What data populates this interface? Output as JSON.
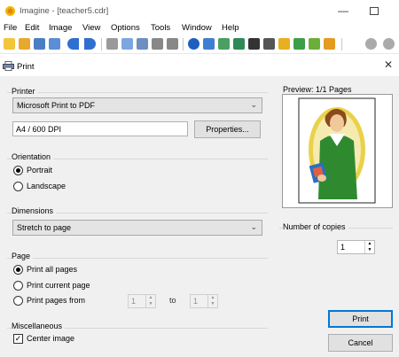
{
  "app": {
    "title": "Imagine - [teacher5.cdr]",
    "min_glyph": "—"
  },
  "menu": [
    "File",
    "Edit",
    "Image",
    "View",
    "Options",
    "Tools",
    "Window",
    "Help"
  ],
  "dialog": {
    "title": "Print",
    "close_glyph": "✕"
  },
  "printer": {
    "label": "Printer",
    "selected": "Microsoft Print to PDF",
    "info": "A4  /  600 DPI",
    "properties_label": "Properties..."
  },
  "orientation": {
    "label": "Orientation",
    "portrait": "Portrait",
    "landscape": "Landscape",
    "selected": "Portrait"
  },
  "dimensions": {
    "label": "Dimensions",
    "selected": "Stretch to page"
  },
  "page": {
    "label": "Page",
    "all": "Print all pages",
    "current": "Print current page",
    "range": "Print pages from",
    "from": "1",
    "to_label": "to",
    "to": "1",
    "selected": "all"
  },
  "misc": {
    "label": "Miscellaneous",
    "center_image": "Center image",
    "center_checked": true
  },
  "preview": {
    "label": "Preview: 1/1 Pages"
  },
  "copies": {
    "label": "Number of copies",
    "value": "1"
  },
  "actions": {
    "print": "Print",
    "cancel": "Cancel"
  },
  "colors": {
    "dialog_bg": "#f0f0f0",
    "default_button_border": "#0078d7"
  }
}
